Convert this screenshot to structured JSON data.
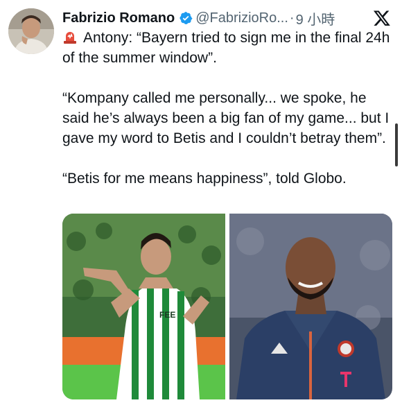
{
  "tweet": {
    "author_name": "Fabrizio Romano",
    "handle": "@FabrizioRo...",
    "separator": "·",
    "timestamp": "9 小時",
    "paragraphs": [
      "Antony: “Bayern tried to sign me in the final 24h of the summer window”.",
      "“Kompany called me personally... we spoke, he said he’s always been a big fan of my game... but I gave my word to Betis and I couldn’t betray them”.",
      "“Betis for me means happiness”, told Globo."
    ],
    "verified_color": "#1d9bf0"
  },
  "icons": {
    "verified": "verified-badge-icon",
    "siren": "siren-emoji-icon",
    "platform": "x-logo-icon"
  },
  "media": {
    "count": 2,
    "shirt_sponsor_text": "FEE"
  }
}
